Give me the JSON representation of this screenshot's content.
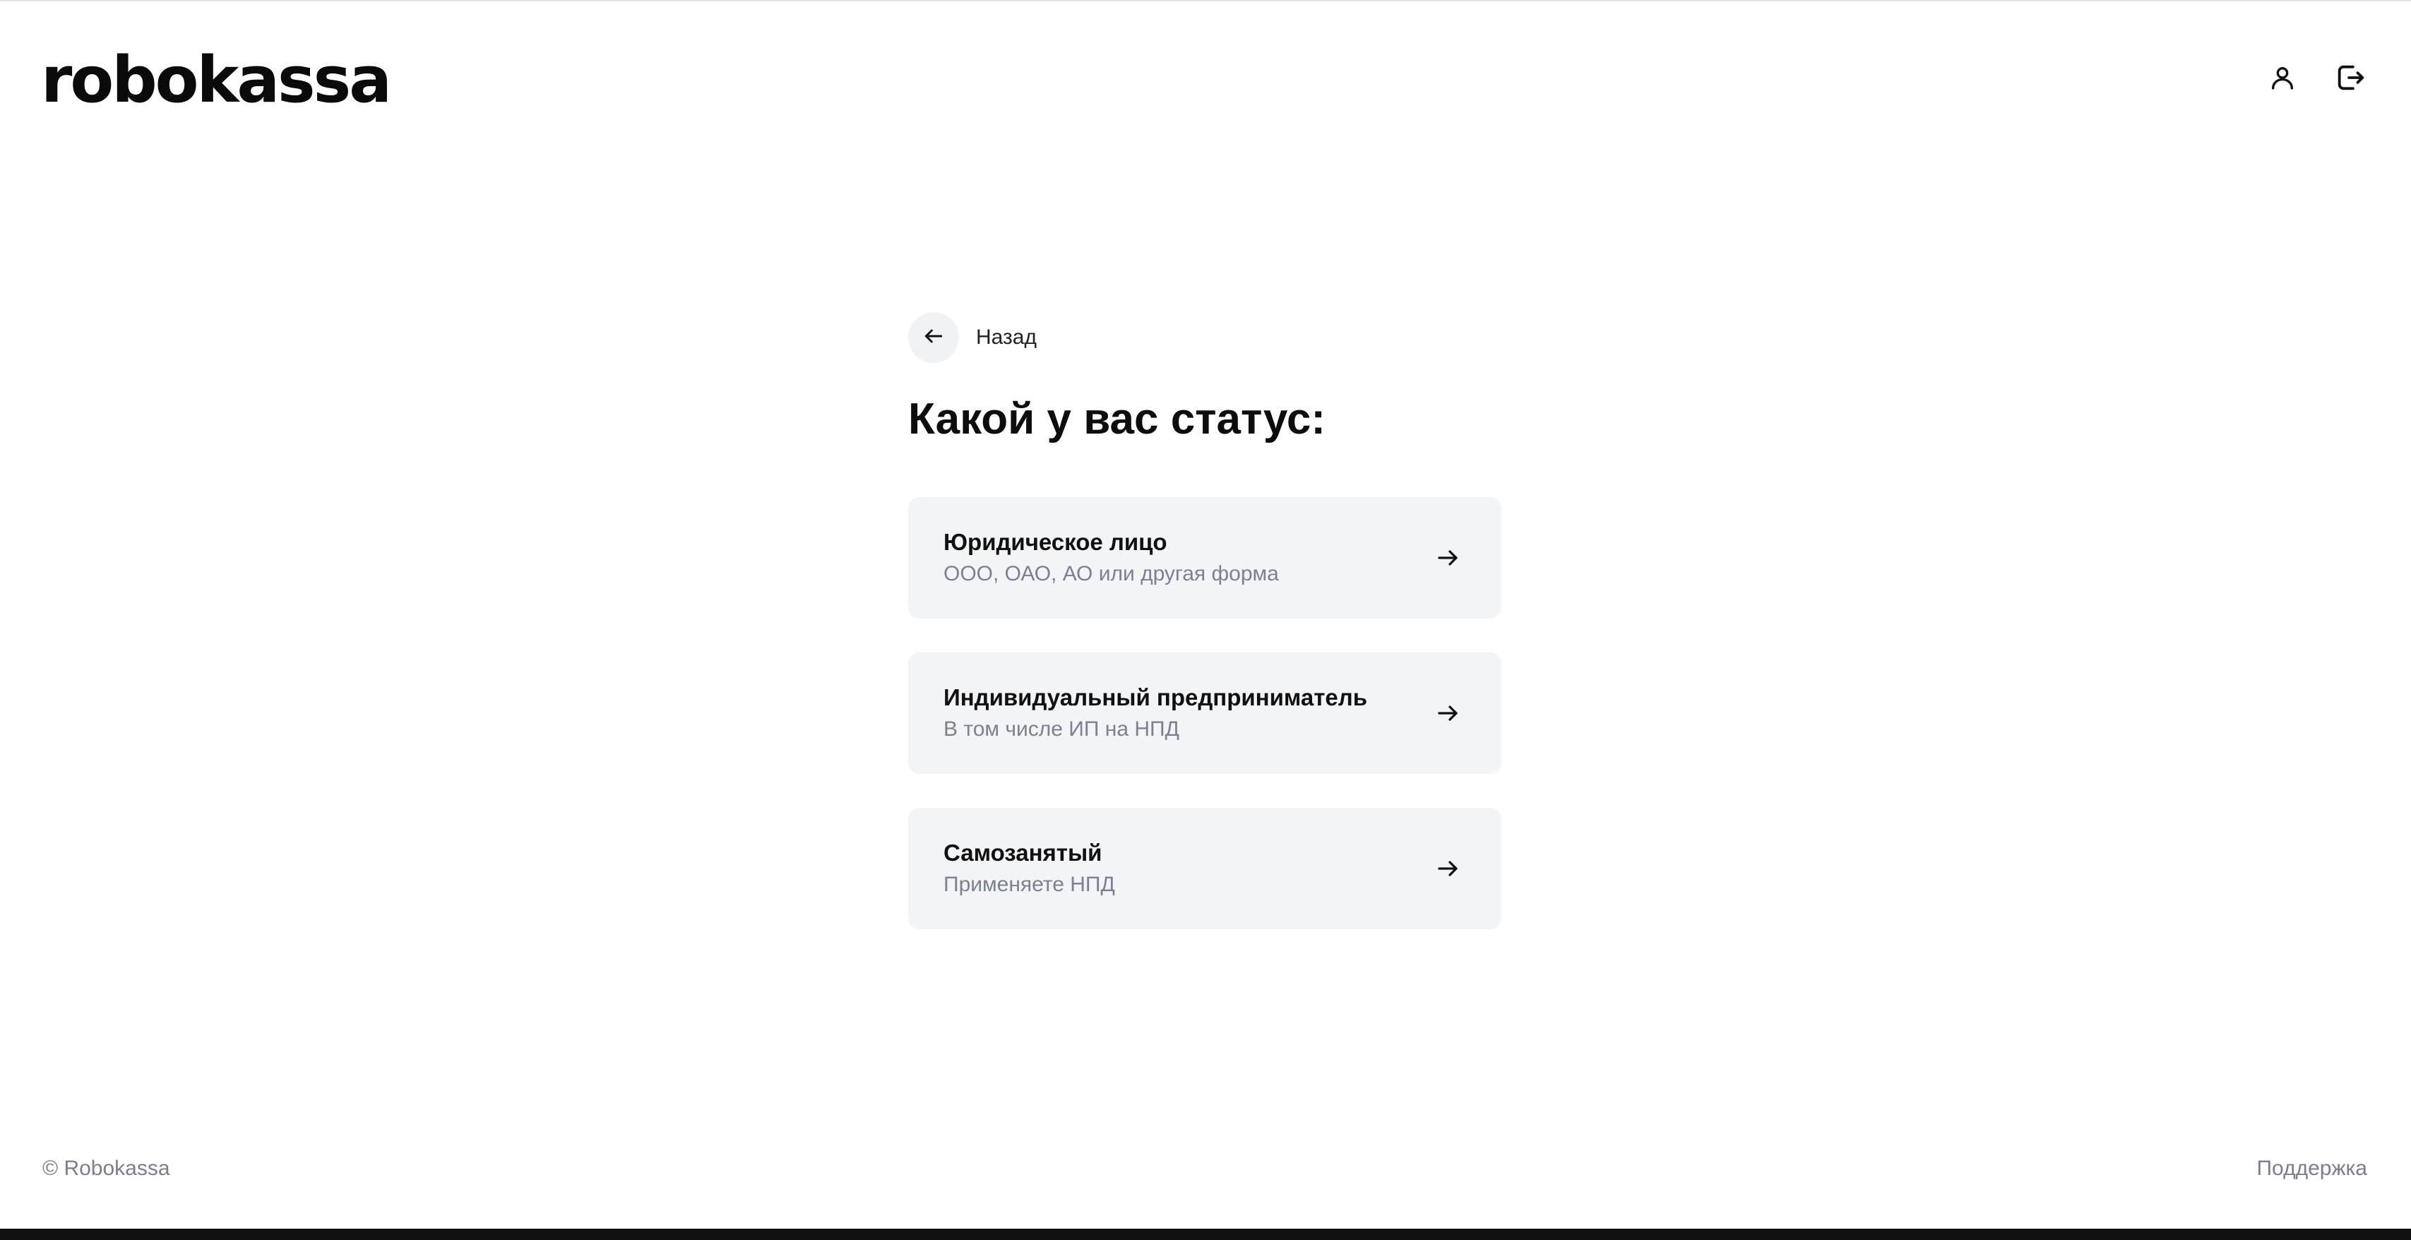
{
  "header": {
    "logo_text": "robokassa",
    "icons": {
      "profile": "user-icon",
      "logout": "logout-icon"
    }
  },
  "main": {
    "back_label": "Назад",
    "back_icon": "arrow-left-icon",
    "title": "Какой у вас статус:",
    "options": [
      {
        "title": "Юридическое лицо",
        "subtitle": "ООО, ОАО, АО или другая форма",
        "icon": "arrow-right-icon"
      },
      {
        "title": "Индивидуальный предприниматель",
        "subtitle": "В том числе ИП на НПД",
        "icon": "arrow-right-icon"
      },
      {
        "title": "Самозанятый",
        "subtitle": "Применяете НПД",
        "icon": "arrow-right-icon"
      }
    ]
  },
  "footer": {
    "copyright": "© Robokassa",
    "support_link": "Поддержка"
  },
  "colors": {
    "card_background": "#f3f4f6",
    "muted_text": "#7b8190",
    "primary_text": "#111111"
  }
}
